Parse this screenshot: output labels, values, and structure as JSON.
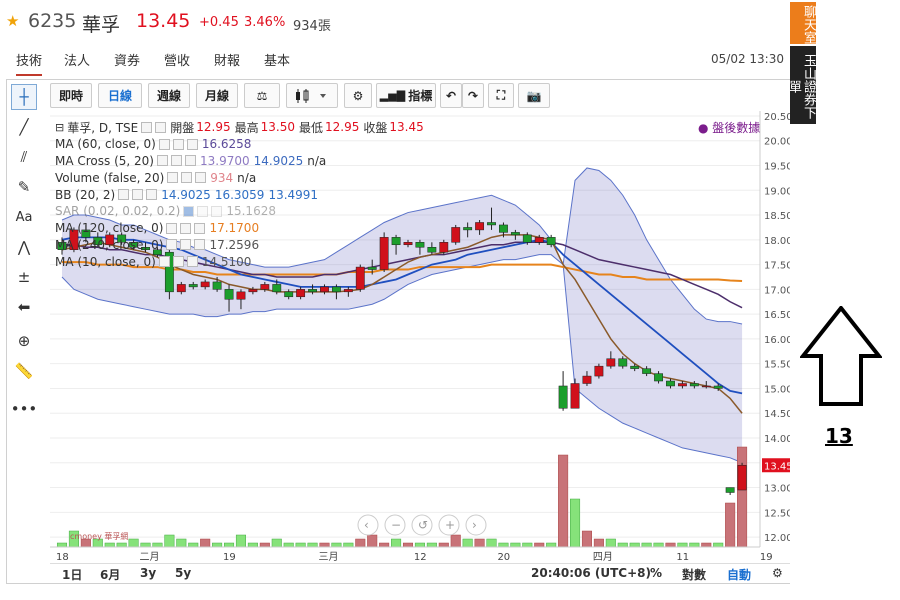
{
  "header": {
    "code": "6235",
    "name": "華孚",
    "price": "13.45",
    "change": "+0.45",
    "pct": "3.46%",
    "volume": "934張",
    "colors": {
      "up": "#e0101f",
      "star": "#f0a30a"
    }
  },
  "tabs": [
    "技術",
    "法人",
    "資券",
    "營收",
    "財報",
    "基本"
  ],
  "timestamp": "05/02 13:30",
  "toolbar": {
    "buttons": [
      "即時",
      "日線",
      "週線",
      "月線",
      "⚖",
      "",
      "",
      "⚙",
      "",
      "指標",
      "↶",
      "↷",
      "⛶",
      "📷"
    ],
    "active": "日線"
  },
  "left_tools": [
    "crosshair-icon",
    "line-icon",
    "fib-icon",
    "brush-icon",
    "text-icon",
    "pattern-icon",
    "measure-icon",
    "arrow-icon",
    "zoom-icon",
    "ruler-icon",
    "more-icon"
  ],
  "legend": {
    "rows": [
      {
        "name": "華孚, D, TSE",
        "values": [
          "開盤",
          "12.95",
          "最高",
          "13.50",
          "最低",
          "12.95",
          "收盤",
          "13.45"
        ]
      },
      {
        "name": "MA (60, close, 0)",
        "values": [
          "16.6258"
        ]
      },
      {
        "name": "MA Cross (5, 20)",
        "values": [
          "13.9700",
          "14.9025",
          "n/a"
        ]
      },
      {
        "name": "Volume (false, 20)",
        "values": [
          "934",
          "n/a"
        ]
      },
      {
        "name": "BB (20, 2)",
        "values": [
          "14.9025",
          "16.3059",
          "13.4991"
        ]
      },
      {
        "name": "SAR (0.02, 0.02, 0.2)",
        "values": [
          "15.1628"
        ]
      },
      {
        "name": "MA (120, close, 0)",
        "values": [
          "17.1700"
        ]
      },
      {
        "name": "MA (240, close, 0)",
        "values": [
          "17.2596"
        ]
      },
      {
        "name": "MA (10, close, 0)",
        "values": [
          "14.5100"
        ]
      }
    ]
  },
  "after_hours": "● 盤後數據",
  "bottom": {
    "ranges": [
      "1日",
      "6月",
      "3y",
      "5y"
    ],
    "time": "20:40:06 (UTC+8)",
    "pct": "%",
    "log": "對數",
    "auto": "自動",
    "gear": "⚙"
  },
  "side": {
    "chat": "聊天室",
    "broker": "玉山證券下單",
    "number": "13"
  },
  "chart_data": {
    "type": "candlestick",
    "y_ticks": [
      "20.50",
      "20.00",
      "19.50",
      "19.00",
      "18.50",
      "18.00",
      "17.50",
      "17.00",
      "16.50",
      "16.00",
      "15.50",
      "15.00",
      "14.50",
      "14.00",
      "13.50",
      "13.00",
      "12.50",
      "12.00"
    ],
    "ylim": [
      11.8,
      20.6
    ],
    "x_labels": [
      "18",
      "二月",
      "19",
      "三月",
      "12",
      "20",
      "四月",
      "11",
      "19",
      "五月"
    ],
    "x_label_days": [
      0,
      7,
      14,
      22,
      30,
      37,
      45,
      52,
      59,
      67
    ],
    "last_price_label": "13.45",
    "watermark": "cmoney 華孚網",
    "candles": [
      [
        17.95,
        17.8,
        18.05,
        17.7
      ],
      [
        17.8,
        18.2,
        18.25,
        17.75
      ],
      [
        18.2,
        18.05,
        18.3,
        17.95
      ],
      [
        18.05,
        17.9,
        18.15,
        17.85
      ],
      [
        17.9,
        18.1,
        18.15,
        17.85
      ],
      [
        18.1,
        17.95,
        18.15,
        17.9
      ],
      [
        17.95,
        17.85,
        18.0,
        17.8
      ],
      [
        17.85,
        17.8,
        17.95,
        17.75
      ],
      [
        17.8,
        17.7,
        17.85,
        17.65
      ],
      [
        17.75,
        16.95,
        17.8,
        16.8
      ],
      [
        16.95,
        17.1,
        17.15,
        16.9
      ],
      [
        17.1,
        17.05,
        17.15,
        17.0
      ],
      [
        17.05,
        17.15,
        17.2,
        17.0
      ],
      [
        17.15,
        17.0,
        17.25,
        16.95
      ],
      [
        17.0,
        16.8,
        17.1,
        16.55
      ],
      [
        16.8,
        16.95,
        17.0,
        16.6
      ],
      [
        16.95,
        17.0,
        17.05,
        16.9
      ],
      [
        17.0,
        17.1,
        17.15,
        16.95
      ],
      [
        17.1,
        16.95,
        17.2,
        16.9
      ],
      [
        16.95,
        16.85,
        17.0,
        16.8
      ],
      [
        16.85,
        17.0,
        17.05,
        16.8
      ],
      [
        17.0,
        16.95,
        17.1,
        16.9
      ],
      [
        16.95,
        17.05,
        17.1,
        16.9
      ],
      [
        17.05,
        16.95,
        17.1,
        16.8
      ],
      [
        16.95,
        17.0,
        17.05,
        16.85
      ],
      [
        17.0,
        17.45,
        17.5,
        16.95
      ],
      [
        17.45,
        17.4,
        17.6,
        17.3
      ],
      [
        17.4,
        18.05,
        18.15,
        17.35
      ],
      [
        18.05,
        17.9,
        18.1,
        17.7
      ],
      [
        17.9,
        17.95,
        18.0,
        17.85
      ],
      [
        17.95,
        17.85,
        18.0,
        17.7
      ],
      [
        17.85,
        17.75,
        17.95,
        17.7
      ],
      [
        17.75,
        17.95,
        18.0,
        17.7
      ],
      [
        17.95,
        18.25,
        18.3,
        17.9
      ],
      [
        18.25,
        18.2,
        18.35,
        18.05
      ],
      [
        18.2,
        18.35,
        18.4,
        18.1
      ],
      [
        18.35,
        18.3,
        18.65,
        18.2
      ],
      [
        18.3,
        18.15,
        18.35,
        18.05
      ],
      [
        18.15,
        18.1,
        18.2,
        18.0
      ],
      [
        18.1,
        17.95,
        18.15,
        17.9
      ],
      [
        17.95,
        18.05,
        18.1,
        17.9
      ],
      [
        18.05,
        17.9,
        18.1,
        17.85
      ],
      [
        15.05,
        14.6,
        15.35,
        14.55
      ],
      [
        14.6,
        15.1,
        15.2,
        14.9
      ],
      [
        15.1,
        15.25,
        15.35,
        15.05
      ],
      [
        15.25,
        15.45,
        15.5,
        15.2
      ],
      [
        15.45,
        15.6,
        15.75,
        15.4
      ],
      [
        15.6,
        15.45,
        15.65,
        15.4
      ],
      [
        15.45,
        15.4,
        15.5,
        15.35
      ],
      [
        15.4,
        15.3,
        15.45,
        15.25
      ],
      [
        15.3,
        15.15,
        15.35,
        15.1
      ],
      [
        15.15,
        15.05,
        15.2,
        15.0
      ],
      [
        15.05,
        15.1,
        15.15,
        15.0
      ],
      [
        15.1,
        15.05,
        15.15,
        15.0
      ],
      [
        15.05,
        15.05,
        15.15,
        15.0
      ],
      [
        15.05,
        15.0,
        15.1,
        14.95
      ],
      [
        13.0,
        12.9,
        13.0,
        12.85
      ],
      [
        12.95,
        13.45,
        13.5,
        12.95
      ]
    ],
    "volumes": [
      1,
      4,
      2,
      2,
      1,
      1,
      2,
      1,
      1,
      3,
      2,
      1,
      2,
      1,
      1,
      3,
      1,
      1,
      2,
      1,
      1,
      1,
      1,
      1,
      1,
      2,
      3,
      1,
      2,
      1,
      1,
      1,
      1,
      3,
      2,
      2,
      2,
      1,
      1,
      1,
      1,
      1,
      23,
      12,
      4,
      2,
      2,
      1,
      1,
      1,
      1,
      1,
      1,
      1,
      1,
      1,
      11,
      25
    ],
    "vol_colors": [
      "g",
      "g",
      "r",
      "g",
      "g",
      "g",
      "g",
      "g",
      "g",
      "g",
      "g",
      "g",
      "r",
      "g",
      "g",
      "g",
      "g",
      "r",
      "g",
      "g",
      "g",
      "g",
      "r",
      "g",
      "g",
      "r",
      "r",
      "r",
      "g",
      "r",
      "g",
      "g",
      "r",
      "r",
      "g",
      "r",
      "g",
      "g",
      "g",
      "g",
      "r",
      "g",
      "r",
      "g",
      "r",
      "r",
      "g",
      "g",
      "g",
      "g",
      "g",
      "r",
      "g",
      "g",
      "r",
      "g",
      "r",
      "r"
    ],
    "bb_upper": [
      18.4,
      18.5,
      18.5,
      18.45,
      18.4,
      18.3,
      18.3,
      18.2,
      18.1,
      18.0,
      17.95,
      17.85,
      17.8,
      17.7,
      17.6,
      17.55,
      17.5,
      17.45,
      17.45,
      17.45,
      17.5,
      17.55,
      17.6,
      17.75,
      17.9,
      18.05,
      18.2,
      18.35,
      18.45,
      18.55,
      18.6,
      18.65,
      18.7,
      18.75,
      18.8,
      18.85,
      18.9,
      18.8,
      18.7,
      18.5,
      18.3,
      18.0,
      17.5,
      19.2,
      19.45,
      19.4,
      19.2,
      18.9,
      18.5,
      18.0,
      17.6,
      17.2,
      16.9,
      16.6,
      16.4,
      16.35,
      16.35,
      16.3
    ],
    "bb_lower": [
      17.25,
      17.0,
      16.9,
      16.8,
      16.75,
      16.7,
      16.65,
      16.6,
      16.55,
      16.5,
      16.5,
      16.5,
      16.45,
      16.45,
      16.5,
      16.5,
      16.55,
      16.55,
      16.6,
      16.6,
      16.6,
      16.6,
      16.6,
      16.6,
      16.6,
      16.65,
      16.7,
      16.8,
      16.95,
      17.1,
      17.2,
      17.3,
      17.35,
      17.4,
      17.45,
      17.5,
      17.55,
      17.6,
      17.6,
      17.65,
      17.7,
      17.7,
      17.5,
      15.0,
      14.8,
      14.6,
      14.45,
      14.3,
      14.2,
      14.1,
      14.0,
      13.9,
      13.8,
      13.75,
      13.7,
      13.65,
      13.6,
      13.5
    ],
    "ma10": [
      17.8,
      17.85,
      17.9,
      17.95,
      17.9,
      17.85,
      17.8,
      17.75,
      17.65,
      17.5,
      17.4,
      17.3,
      17.25,
      17.2,
      17.1,
      17.05,
      17.0,
      17.0,
      16.95,
      16.95,
      16.95,
      16.95,
      16.95,
      16.95,
      16.97,
      17.0,
      17.1,
      17.25,
      17.4,
      17.55,
      17.65,
      17.7,
      17.75,
      17.8,
      17.85,
      17.95,
      18.05,
      18.1,
      18.1,
      18.1,
      18.05,
      18.0,
      17.5,
      17.2,
      16.8,
      16.4,
      16.0,
      15.7,
      15.5,
      15.35,
      15.25,
      15.2,
      15.15,
      15.1,
      15.05,
      15.0,
      14.8,
      14.5
    ],
    "ma20": [
      18.0,
      18.05,
      18.05,
      18.05,
      18.05,
      18.0,
      18.0,
      17.95,
      17.9,
      17.85,
      17.8,
      17.7,
      17.6,
      17.5,
      17.4,
      17.3,
      17.25,
      17.2,
      17.15,
      17.1,
      17.05,
      17.05,
      17.05,
      17.05,
      17.05,
      17.05,
      17.1,
      17.15,
      17.2,
      17.3,
      17.4,
      17.5,
      17.55,
      17.6,
      17.7,
      17.75,
      17.8,
      17.85,
      17.9,
      17.95,
      18.0,
      17.95,
      17.7,
      17.5,
      17.3,
      17.1,
      16.9,
      16.7,
      16.5,
      16.3,
      16.1,
      15.9,
      15.7,
      15.5,
      15.3,
      15.1,
      14.95,
      14.9
    ],
    "ma60": [
      17.9,
      17.9,
      17.85,
      17.85,
      17.8,
      17.8,
      17.75,
      17.7,
      17.7,
      17.65,
      17.6,
      17.55,
      17.5,
      17.45,
      17.4,
      17.35,
      17.3,
      17.3,
      17.25,
      17.25,
      17.25,
      17.25,
      17.3,
      17.3,
      17.35,
      17.4,
      17.45,
      17.5,
      17.55,
      17.6,
      17.65,
      17.7,
      17.7,
      17.75,
      17.8,
      17.85,
      17.9,
      17.9,
      17.95,
      17.95,
      17.95,
      17.95,
      17.9,
      17.8,
      17.7,
      17.6,
      17.55,
      17.5,
      17.45,
      17.4,
      17.35,
      17.3,
      17.2,
      17.1,
      17.0,
      16.9,
      16.75,
      16.63
    ],
    "ma120": [
      17.55,
      17.55,
      17.55,
      17.5,
      17.5,
      17.5,
      17.45,
      17.45,
      17.45,
      17.4,
      17.4,
      17.35,
      17.35,
      17.3,
      17.3,
      17.3,
      17.3,
      17.3,
      17.3,
      17.3,
      17.3,
      17.3,
      17.3,
      17.3,
      17.35,
      17.35,
      17.35,
      17.4,
      17.4,
      17.4,
      17.45,
      17.45,
      17.45,
      17.45,
      17.45,
      17.45,
      17.5,
      17.5,
      17.5,
      17.5,
      17.5,
      17.5,
      17.45,
      17.4,
      17.35,
      17.3,
      17.3,
      17.25,
      17.25,
      17.2,
      17.2,
      17.2,
      17.2,
      17.2,
      17.2,
      17.2,
      17.18,
      17.17
    ]
  }
}
